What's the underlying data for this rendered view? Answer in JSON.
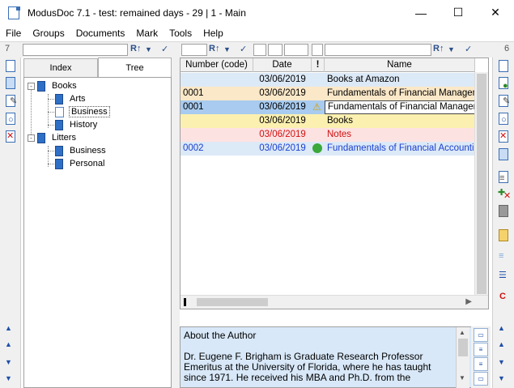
{
  "window": {
    "title": "ModusDoc 7.1 - test: remained days - 29 | 1 - Main",
    "minimize": "—",
    "maximize": "☐",
    "close": "✕"
  },
  "menu": [
    "File",
    "Groups",
    "Documents",
    "Mark",
    "Tools",
    "Help"
  ],
  "filterbar": {
    "left_count": "7",
    "right_count": "6",
    "sort_icon": "R↑",
    "filter_icon": "▼",
    "check_icon": "✓"
  },
  "tabs": {
    "index": "Index",
    "tree": "Tree"
  },
  "tree": {
    "nodes": [
      {
        "label": "Books",
        "expanded": "-"
      },
      {
        "label": "Arts"
      },
      {
        "label": "Business"
      },
      {
        "label": "History"
      },
      {
        "label": "Litters",
        "expanded": "-"
      },
      {
        "label": "Business"
      },
      {
        "label": "Personal"
      }
    ]
  },
  "grid": {
    "headers": [
      "Number (code)",
      "Date",
      "!",
      "Name"
    ],
    "rows": [
      {
        "number": "",
        "date": "03/06/2019",
        "flag": "",
        "name": "Books at Amazon",
        "bg": "#dce9f7",
        "color": "#000000",
        "datecolor": "#000000"
      },
      {
        "number": "0001",
        "date": "03/06/2019",
        "flag": "",
        "name": "Fundamentals of Financial Management",
        "bg": "#fbe8c8",
        "color": "#000000",
        "datecolor": "#000000"
      },
      {
        "number": "0001",
        "date": "03/06/2019",
        "flag": "warning",
        "name": "Fundamentals of Financial Management",
        "bg": "#a8cbef",
        "color": "#000000",
        "datecolor": "#000000"
      },
      {
        "number": "",
        "date": "03/06/2019",
        "flag": "",
        "name": "Books",
        "bg": "#fcf0b0",
        "color": "#000000",
        "datecolor": "#000000"
      },
      {
        "number": "",
        "date": "03/06/2019",
        "flag": "",
        "name": "Notes",
        "bg": "#fde2e2",
        "color": "#d01010",
        "datecolor": "#d01010"
      },
      {
        "number": "0002",
        "date": "03/06/2019",
        "flag": "ok",
        "name": "Fundamentals of Financial Accounting",
        "bg": "#dce9f7",
        "color": "#1a3fcf",
        "datecolor": "#1a3fcf"
      }
    ]
  },
  "memo": {
    "lines": [
      "About the Author",
      "",
      "Dr. Eugene F. Brigham is Graduate Research Professor",
      "Emeritus at the University of Florida, where he has taught",
      "since 1971. He received his MBA and Ph.D. from the"
    ]
  }
}
